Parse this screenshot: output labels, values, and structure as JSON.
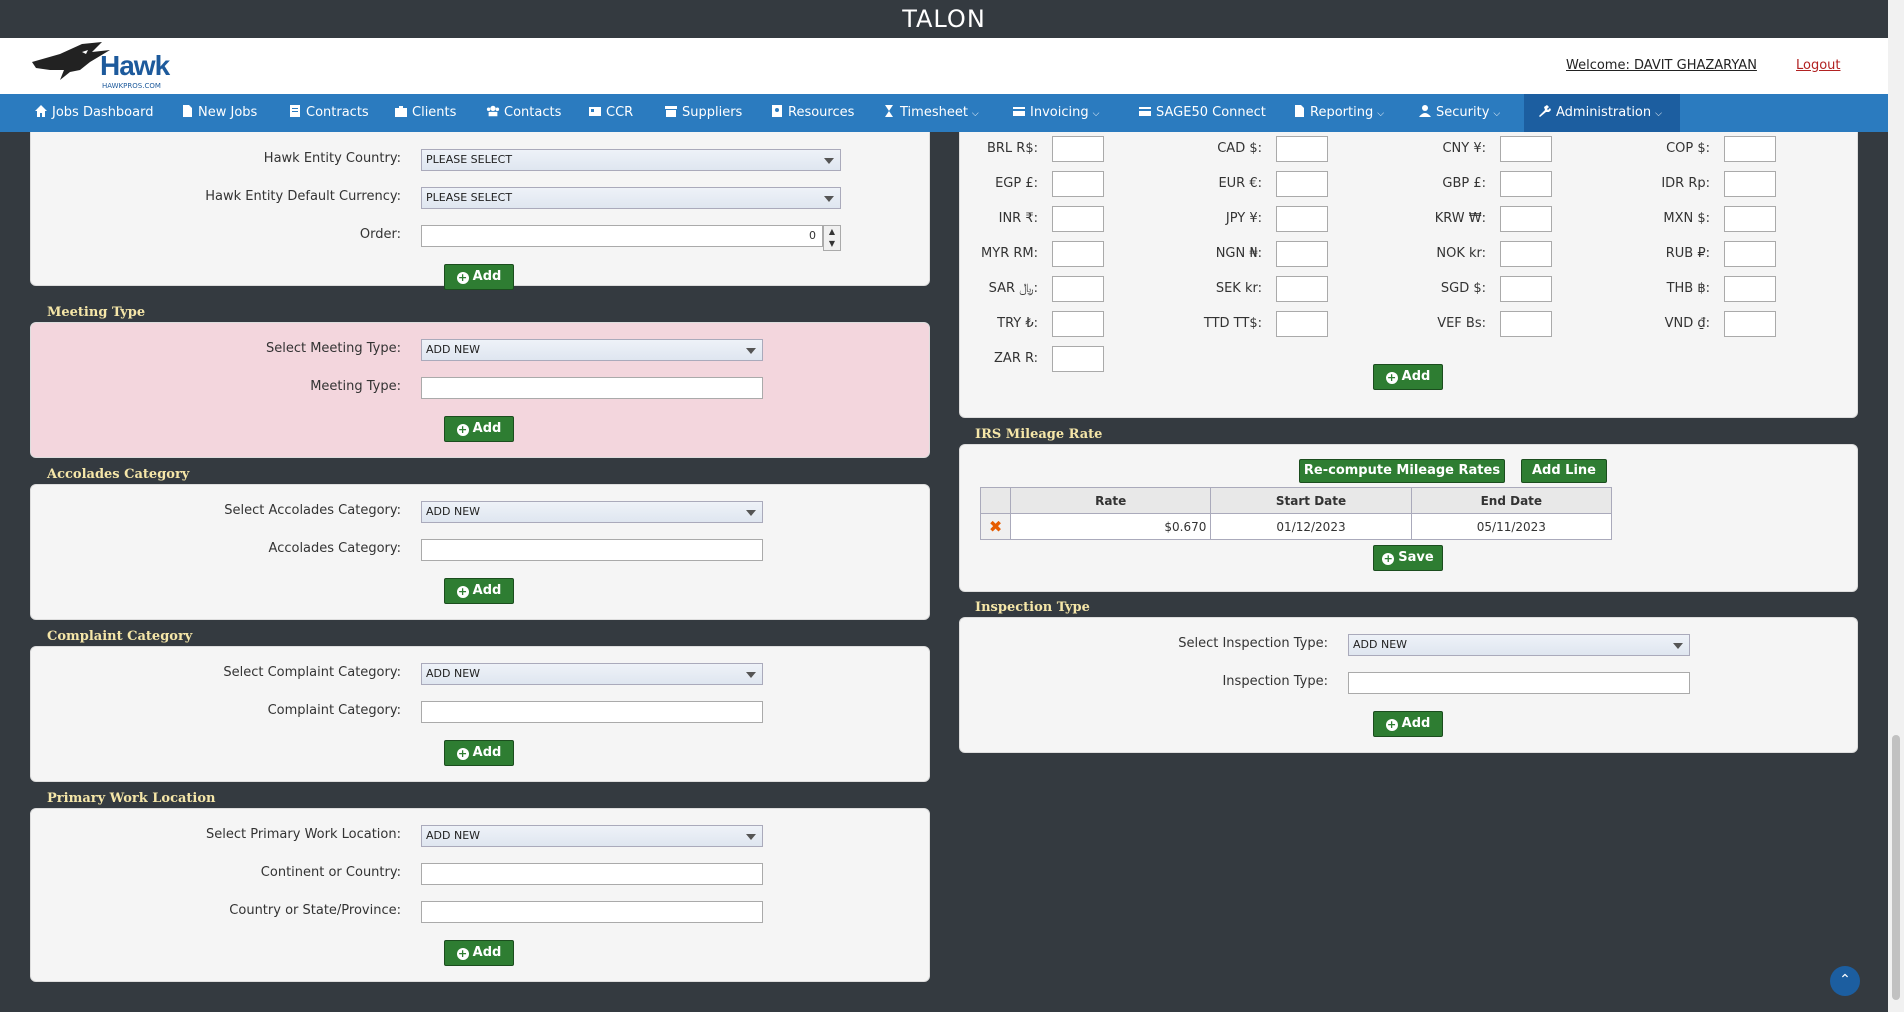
{
  "app_title": "TALON",
  "brand": {
    "logo_text": "Hawk",
    "logo_sub": "HAWKPROS.COM"
  },
  "user": {
    "welcome": "Welcome: DAVIT GHAZARYAN",
    "logout": "Logout"
  },
  "nav": [
    {
      "label": "Jobs Dashboard",
      "icon": "home-icon"
    },
    {
      "label": "New Jobs",
      "icon": "file-icon"
    },
    {
      "label": "Contracts",
      "icon": "contract-icon"
    },
    {
      "label": "Clients",
      "icon": "briefcase-icon"
    },
    {
      "label": "Contacts",
      "icon": "users-icon"
    },
    {
      "label": "CCR",
      "icon": "id-card-icon"
    },
    {
      "label": "Suppliers",
      "icon": "warehouse-icon"
    },
    {
      "label": "Resources",
      "icon": "resource-icon"
    },
    {
      "label": "Timesheet",
      "icon": "hourglass-icon"
    },
    {
      "label": "Invoicing",
      "icon": "credit-card-icon"
    },
    {
      "label": "SAGE50 Connect",
      "icon": "credit-card-icon"
    },
    {
      "label": "Reporting",
      "icon": "report-icon"
    },
    {
      "label": "Security",
      "icon": "user-icon"
    },
    {
      "label": "Administration",
      "icon": "wrench-icon"
    }
  ],
  "hawk_entity": {
    "country_label": "Hawk Entity Country:",
    "country_value": "PLEASE SELECT",
    "currency_label": "Hawk Entity Default Currency:",
    "currency_value": "PLEASE SELECT",
    "order_label": "Order:",
    "order_value": "0",
    "add_label": "Add"
  },
  "meeting_type": {
    "title": "Meeting Type",
    "select_label": "Select Meeting Type:",
    "select_value": "ADD NEW",
    "field_label": "Meeting Type:",
    "add_label": "Add"
  },
  "accolades": {
    "title": "Accolades Category",
    "select_label": "Select Accolades Category:",
    "select_value": "ADD NEW",
    "field_label": "Accolades Category:",
    "add_label": "Add"
  },
  "complaint": {
    "title": "Complaint Category",
    "select_label": "Select Complaint Category:",
    "select_value": "ADD NEW",
    "field_label": "Complaint Category:",
    "add_label": "Add"
  },
  "primary_location": {
    "title": "Primary Work Location",
    "select_label": "Select Primary Work Location:",
    "select_value": "ADD NEW",
    "continent_label": "Continent or Country:",
    "state_label": "Country or State/Province:",
    "add_label": "Add"
  },
  "currencies": {
    "rows": [
      [
        "BRL R$:",
        "CAD $:",
        "CNY ¥:",
        "COP $:"
      ],
      [
        "EGP £:",
        "EUR €:",
        "GBP £:",
        "IDR Rp:"
      ],
      [
        "INR ₹:",
        "JPY ¥:",
        "KRW ₩:",
        "MXN $:"
      ],
      [
        "MYR RM:",
        "NGN ₦:",
        "NOK kr:",
        "RUB ₽:"
      ],
      [
        "SAR ﷼:",
        "SEK kr:",
        "SGD $:",
        "THB ฿:"
      ],
      [
        "TRY ₺:",
        "TTD TT$:",
        "VEF Bs:",
        "VND ₫:"
      ],
      [
        "ZAR R:"
      ]
    ],
    "add_label": "Add"
  },
  "irs_mileage": {
    "title": "IRS Mileage Rate",
    "recompute_label": "Re-compute Mileage Rates",
    "add_line_label": "Add Line",
    "headers": [
      "Rate",
      "Start Date",
      "End Date"
    ],
    "rows": [
      {
        "rate": "$0.670",
        "start": "01/12/2023",
        "end": "05/11/2023"
      }
    ],
    "save_label": "Save"
  },
  "inspection_type": {
    "title": "Inspection Type",
    "select_label": "Select Inspection Type:",
    "select_value": "ADD NEW",
    "field_label": "Inspection Type:",
    "add_label": "Add"
  }
}
